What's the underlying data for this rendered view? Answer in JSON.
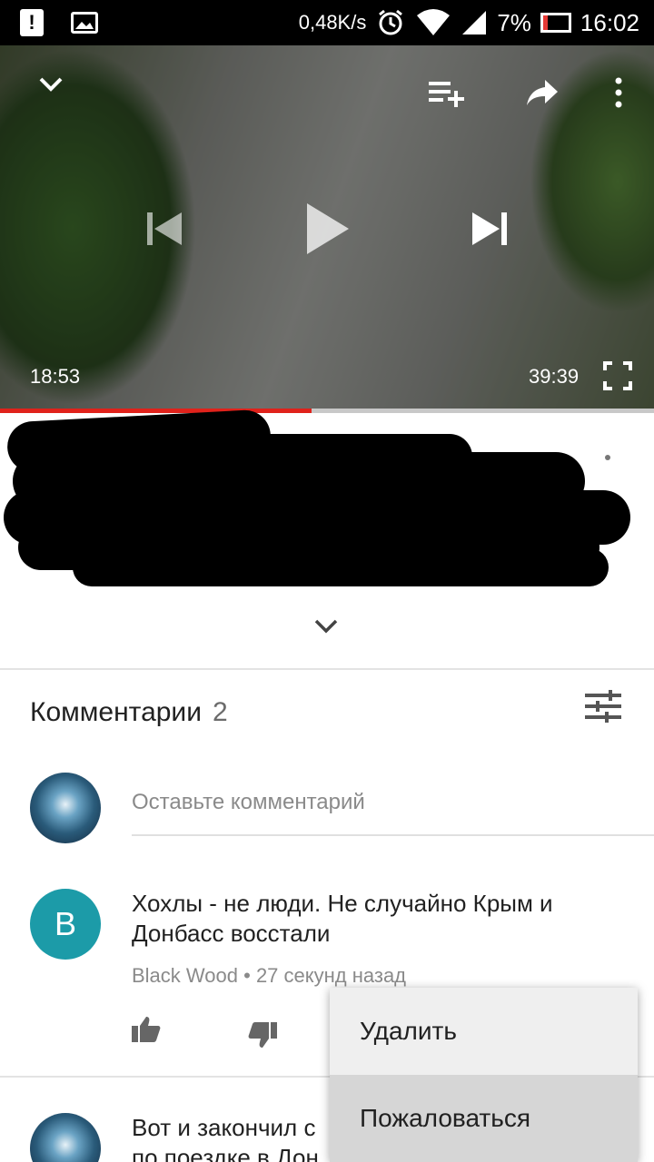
{
  "status_bar": {
    "alert_glyph": "!",
    "net_speed": "0,48K/s",
    "battery": "7%",
    "time": "16:02"
  },
  "player": {
    "current_time": "18:53",
    "duration": "39:39",
    "progress_fraction": 0.476,
    "icons": [
      "collapse-icon",
      "add-to-playlist-icon",
      "share-icon",
      "more-icon",
      "previous-icon",
      "play-icon",
      "next-icon",
      "fullscreen-icon"
    ]
  },
  "comments": {
    "title": "Комментарии",
    "count": "2",
    "input_placeholder": "Оставьте комментарий",
    "items": [
      {
        "avatar_letter": "B",
        "text": "Хохлы - не люди. Не случайно Крым и Донбасс восстали",
        "author": "Black Wood",
        "separator": "•",
        "time": "27 секунд назад"
      },
      {
        "text_partial_line1": "Вот и закончил с",
        "text_partial_line2": "по поездке в Дон"
      }
    ]
  },
  "context_menu": {
    "items": [
      "Удалить",
      "Пожаловаться"
    ]
  },
  "colors": {
    "accent_red": "#e0221b",
    "avatar_teal": "#1c9ba8"
  }
}
